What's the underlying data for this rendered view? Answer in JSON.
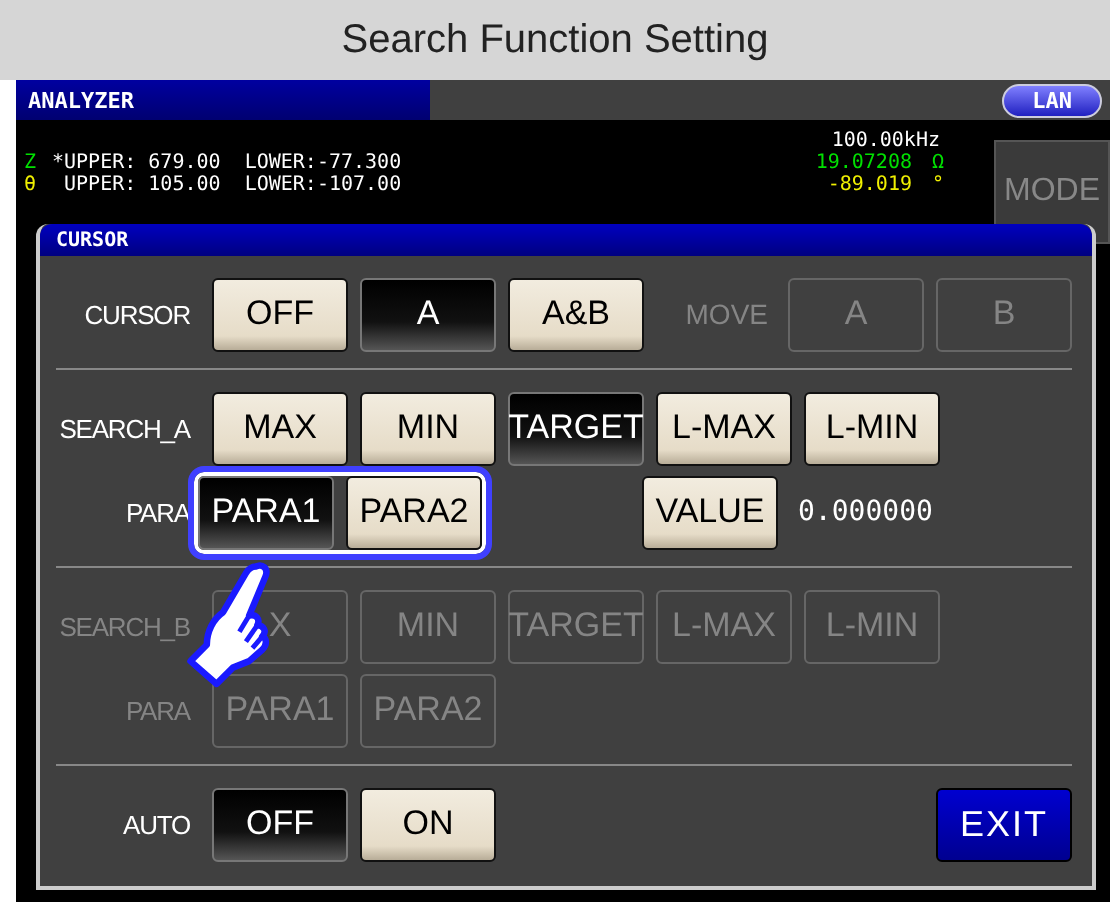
{
  "title": "Search Function Setting",
  "screen": {
    "name": "ANALYZER",
    "lan": "LAN",
    "mode": {
      "label": "MODE",
      "disabled": true
    },
    "frequency": "100.00kHz",
    "params": [
      {
        "symbol": "Z",
        "color": "#00e000",
        "limits": "*UPPER: 679.00  LOWER:-77.300",
        "value": "19.07208",
        "unit": "Ω"
      },
      {
        "symbol": "θ",
        "color": "#f0f000",
        "limits": " UPPER: 105.00  LOWER:-107.00",
        "value": "-89.019",
        "unit": "°"
      }
    ]
  },
  "dialog": {
    "title": "CURSOR",
    "rows": [
      {
        "label": "CURSOR",
        "disabled": false,
        "buttons": [
          {
            "label": "OFF",
            "selected": false
          },
          {
            "label": "A",
            "selected": true
          },
          {
            "label": "A&B",
            "selected": false
          }
        ],
        "move": {
          "label": "MOVE",
          "disabled": true,
          "buttons": [
            "A",
            "B"
          ]
        },
        "divider": true
      },
      {
        "label": "SEARCH_A",
        "disabled": false,
        "buttons": [
          {
            "label": "MAX",
            "selected": false
          },
          {
            "label": "MIN",
            "selected": false
          },
          {
            "label": "TARGET",
            "selected": true
          },
          {
            "label": "L-MAX",
            "selected": false
          },
          {
            "label": "L-MIN",
            "selected": false
          }
        ]
      },
      {
        "label": "PARA",
        "disabled": false,
        "highlighted": true,
        "buttons": [
          {
            "label": "PARA1",
            "selected": true
          },
          {
            "label": "PARA2",
            "selected": false
          }
        ],
        "value_button": "VALUE",
        "value": "0.000000",
        "divider": true
      },
      {
        "label": "SEARCH_B",
        "disabled": true,
        "buttons": [
          {
            "label": "X",
            "selected": false
          },
          {
            "label": "MIN",
            "selected": false
          },
          {
            "label": "TARGET",
            "selected": false
          },
          {
            "label": "L-MAX",
            "selected": false
          },
          {
            "label": "L-MIN",
            "selected": false
          }
        ]
      },
      {
        "label": "PARA",
        "disabled": true,
        "buttons": [
          {
            "label": "PARA1",
            "selected": false
          },
          {
            "label": "PARA2",
            "selected": false
          }
        ],
        "divider": true
      },
      {
        "label": "AUTO",
        "disabled": false,
        "buttons": [
          {
            "label": "OFF",
            "selected": true
          },
          {
            "label": "ON",
            "selected": false
          }
        ],
        "exit": "EXIT"
      }
    ]
  }
}
